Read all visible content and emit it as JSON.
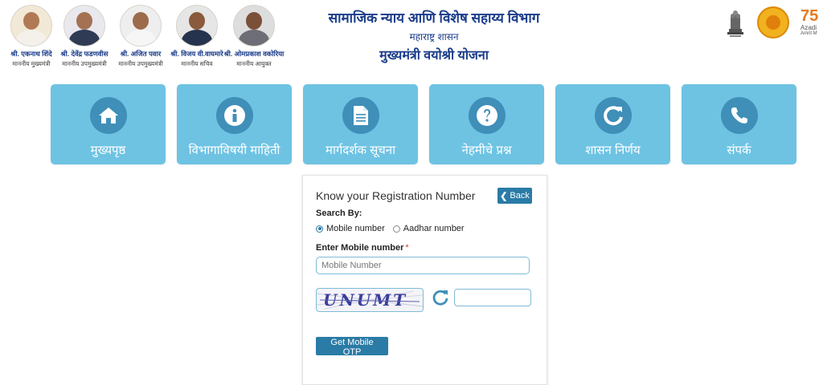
{
  "header": {
    "leaders": [
      {
        "name": "श्री. एकनाथ शिंदे",
        "designation": "माननीय मुख्यमंत्री"
      },
      {
        "name": "श्री. देवेंद्र फडणवीस",
        "designation": "माननीय उपमुख्यमंत्री"
      },
      {
        "name": "श्री. अजित पवार",
        "designation": "माननीय उपमुख्यमंत्री"
      },
      {
        "name": "श्री. विजय वी.वाघमारे",
        "designation": "माननीय सचिव"
      },
      {
        "name": "श्री. ओमप्रकाश वकोरिया",
        "designation": "माननीय आयुक्त"
      }
    ],
    "department_title": "सामाजिक न्याय आणि विशेष सहाय्य विभाग",
    "government": "महाराष्ट्र शासन",
    "scheme_title": "मुख्यमंत्री वयोश्री योजना",
    "azadi_number": "75",
    "azadi_line1": "Azadi",
    "azadi_line2": "Amrit M"
  },
  "nav": {
    "tiles": [
      {
        "label": "मुख्यपृष्ठ",
        "icon": "home-icon"
      },
      {
        "label": "विभागाविषयी माहिती",
        "icon": "info-icon"
      },
      {
        "label": "मार्गदर्शक सूचना",
        "icon": "document-icon"
      },
      {
        "label": "नेहमीचे प्रश्न",
        "icon": "question-icon"
      },
      {
        "label": "शासन निर्णय",
        "icon": "refresh-icon"
      },
      {
        "label": "संपर्क",
        "icon": "phone-icon"
      }
    ],
    "tile_color": "#6ec3e3",
    "icon_circle_color": "#3f8fb8"
  },
  "form": {
    "title": "Know your Registration Number",
    "back_label": "Back",
    "search_by_label": "Search By:",
    "options": [
      "Mobile number",
      "Aadhar number"
    ],
    "selected_option": "Mobile number",
    "mobile_label": "Enter Mobile number",
    "required_mark": "*",
    "mobile_placeholder": "Mobile Number",
    "mobile_value": "",
    "captcha_text": "UNUMT",
    "captcha_input_value": "",
    "submit_label": "Get Mobile OTP",
    "button_color": "#2a7ba6"
  }
}
